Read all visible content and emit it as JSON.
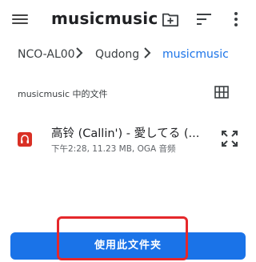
{
  "toolbar": {
    "title": "musicmusic",
    "icons": {
      "menu": "menu-icon",
      "new_folder": "new-folder-icon",
      "sort": "sort-icon",
      "more": "more-vert-icon"
    }
  },
  "breadcrumb": {
    "items": [
      "NCO-AL00",
      "Qudong",
      "musicmusic"
    ],
    "separator_icon": "chevron-right-icon"
  },
  "section": {
    "header": "musicmusic 中的文件",
    "view_toggle_icon": "grid-view-icon"
  },
  "files": [
    {
      "name": "高铃 (Callin') - 愛してる (...",
      "meta": "下午2:28, 11.23 MB, OGA 音频",
      "icon": "audio-file-icon",
      "action_icon": "expand-icon"
    }
  ],
  "footer": {
    "button_label": "使用此文件夹"
  },
  "colors": {
    "accent": "#1a73e8",
    "file_icon": "#d93025",
    "highlight": "#e5282b"
  }
}
